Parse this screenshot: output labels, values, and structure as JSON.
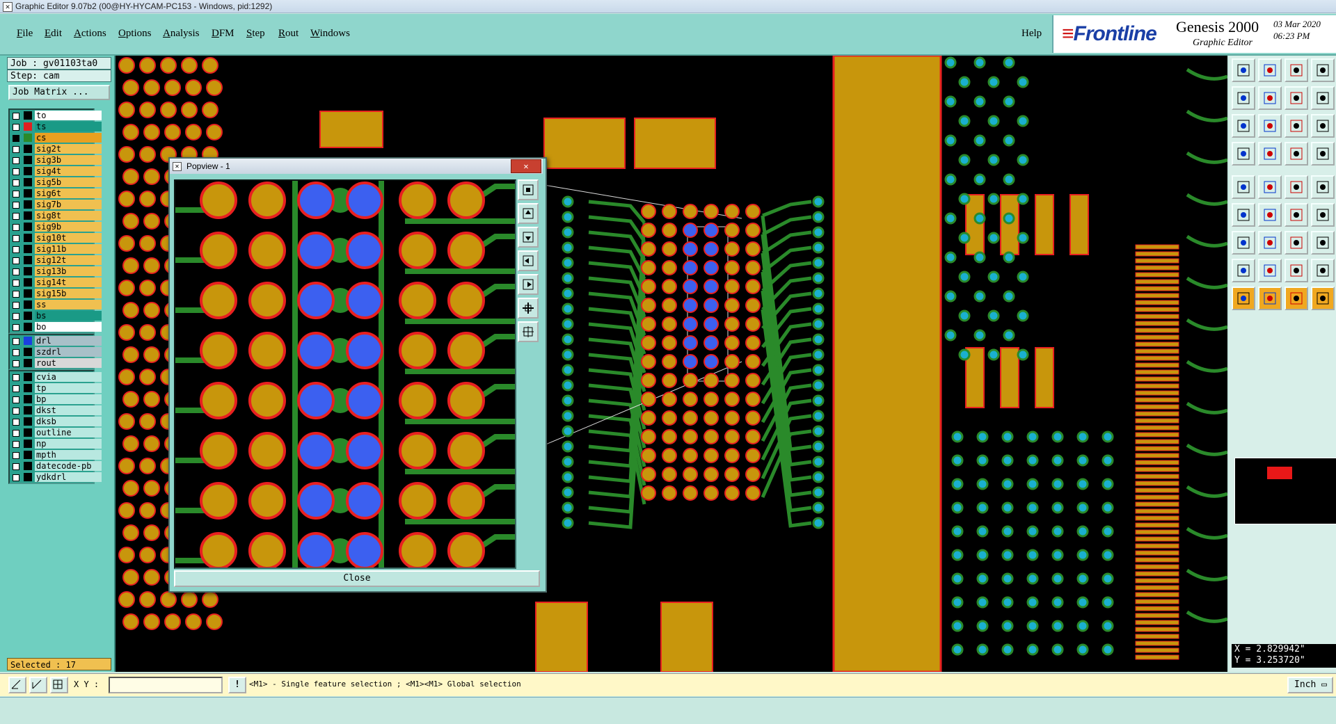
{
  "window": {
    "title": "Graphic Editor 9.07b2 (00@HY-HYCAM-PC153 - Windows, pid:1292)"
  },
  "menu": {
    "items": [
      "File",
      "Edit",
      "Actions",
      "Options",
      "Analysis",
      "DFM",
      "Step",
      "Rout",
      "Windows"
    ],
    "help": "Help"
  },
  "brand": {
    "logo": "Frontline",
    "product": "Genesis 2000",
    "subtitle": "Graphic Editor",
    "date": "03 Mar 2020",
    "time": "06:23 PM"
  },
  "left": {
    "job": "Job : gv01103ta0",
    "step": "Step: cam",
    "job_matrix": "Job Matrix ...",
    "layers_board": [
      {
        "name": "to",
        "bg": "#ffffff",
        "sw": ""
      },
      {
        "name": "ts",
        "bg": "#1a9a86",
        "sw": "#e02020"
      },
      {
        "name": "cs",
        "bg": "#e8a020",
        "sw": "#2a8a2a",
        "active": true
      },
      {
        "name": "sig2t",
        "bg": "#f0c050",
        "sw": ""
      },
      {
        "name": "sig3b",
        "bg": "#f0c050",
        "sw": ""
      },
      {
        "name": "sig4t",
        "bg": "#f0c050",
        "sw": ""
      },
      {
        "name": "sig5b",
        "bg": "#f0c050",
        "sw": ""
      },
      {
        "name": "sig6t",
        "bg": "#f0c050",
        "sw": ""
      },
      {
        "name": "sig7b",
        "bg": "#f0c050",
        "sw": ""
      },
      {
        "name": "sig8t",
        "bg": "#f0c050",
        "sw": ""
      },
      {
        "name": "sig9b",
        "bg": "#f0c050",
        "sw": ""
      },
      {
        "name": "sig10t",
        "bg": "#f0c050",
        "sw": ""
      },
      {
        "name": "sig11b",
        "bg": "#f0c050",
        "sw": ""
      },
      {
        "name": "sig12t",
        "bg": "#f0c050",
        "sw": ""
      },
      {
        "name": "sig13b",
        "bg": "#f0c050",
        "sw": ""
      },
      {
        "name": "sig14t",
        "bg": "#f0c050",
        "sw": ""
      },
      {
        "name": "sig15b",
        "bg": "#f0c050",
        "sw": ""
      },
      {
        "name": "ss",
        "bg": "#f0c050",
        "sw": ""
      },
      {
        "name": "bs",
        "bg": "#1a9a86",
        "sw": ""
      },
      {
        "name": "bo",
        "bg": "#ffffff",
        "sw": ""
      }
    ],
    "layers_drill": [
      {
        "name": "drl",
        "bg": "#a8c0c8",
        "sw": "#1a3fe0"
      },
      {
        "name": "szdrl",
        "bg": "#a8c0c8",
        "sw": ""
      },
      {
        "name": "rout",
        "bg": "#d8d8d8",
        "sw": ""
      }
    ],
    "layers_misc": [
      {
        "name": "cvia",
        "bg": "#b8e8e0",
        "sw": ""
      },
      {
        "name": "tp",
        "bg": "#b8e8e0",
        "sw": ""
      },
      {
        "name": "bp",
        "bg": "#b8e8e0",
        "sw": ""
      },
      {
        "name": "dkst",
        "bg": "#b8e8e0",
        "sw": ""
      },
      {
        "name": "dksb",
        "bg": "#b8e8e0",
        "sw": ""
      },
      {
        "name": "outline",
        "bg": "#b8e8e0",
        "sw": ""
      },
      {
        "name": "np",
        "bg": "#b8e8e0",
        "sw": ""
      },
      {
        "name": "mpth",
        "bg": "#b8e8e0",
        "sw": ""
      },
      {
        "name": "datecode-pb",
        "bg": "#b8e8e0",
        "sw": ""
      },
      {
        "name": "ydkdrl",
        "bg": "#b8e8e0",
        "sw": ""
      }
    ],
    "selected": "Selected : 17"
  },
  "popview": {
    "title": "Popview - 1",
    "close_label": "Close"
  },
  "status": {
    "xy_label": "X Y :",
    "xy_value": "",
    "hint": "<M1> - Single feature selection ; <M1><M1> Global selection",
    "units": "Inch"
  },
  "coords": {
    "x": "X = 2.829942\"",
    "y": "Y = 3.253720\""
  },
  "colors": {
    "background": "#000000",
    "copper": "#c8960c",
    "pad_outline": "#e82020",
    "trace": "#2a8a2a",
    "via": "#1ab0d0",
    "drill": "#3c60f0",
    "panel": "#8fd6cc"
  }
}
